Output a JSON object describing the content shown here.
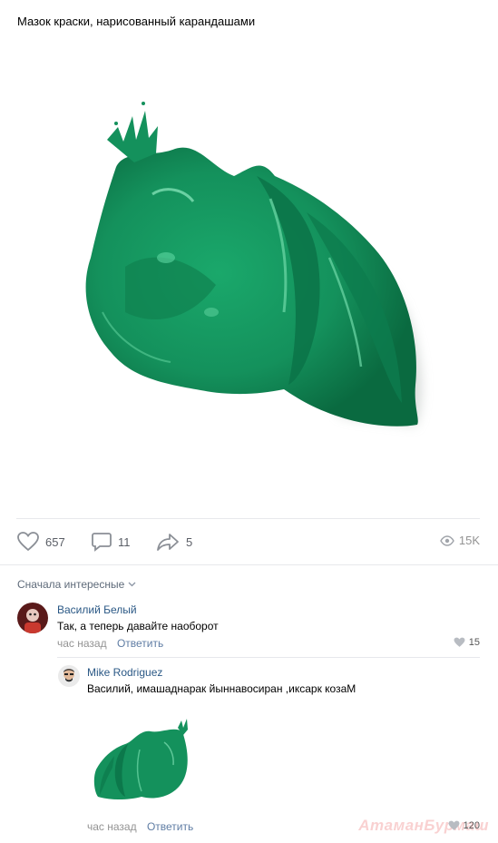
{
  "post": {
    "title": "Мазок краски, нарисованный карандашами"
  },
  "actions": {
    "likes": "657",
    "comments": "11",
    "shares": "5",
    "views": "15K"
  },
  "comments_sort": {
    "label": "Сначала интересные"
  },
  "comments": [
    {
      "author": "Василий Белый",
      "text": "Так, а теперь давайте наоборот",
      "time": "час назад",
      "reply_label": "Ответить",
      "likes": "15"
    },
    {
      "author": "Mike Rodriguez",
      "text": "Василий, имашаднарак йыннавосиран ,иксарк козаМ",
      "time": "час назад",
      "reply_label": "Ответить",
      "likes": "120"
    }
  ],
  "watermark": "АтаманБурмаш",
  "colors": {
    "paint_green": "#14915c",
    "paint_dark": "#0a6a40",
    "link_blue": "#2a5885",
    "muted_gray": "#939393",
    "divider": "#e7e8ec"
  },
  "icons": [
    "heart-icon",
    "comment-icon",
    "share-icon",
    "eye-icon",
    "chevron-down-icon"
  ]
}
